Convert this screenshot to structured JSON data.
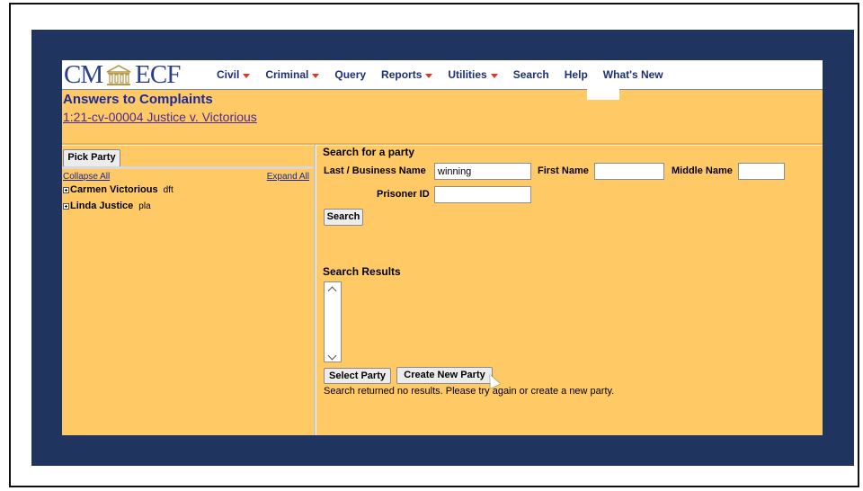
{
  "menu": {
    "items": [
      {
        "label": "Civil",
        "has_caret": true
      },
      {
        "label": "Criminal",
        "has_caret": true
      },
      {
        "label": "Query",
        "has_caret": false
      },
      {
        "label": "Reports",
        "has_caret": true
      },
      {
        "label": "Utilities",
        "has_caret": true
      },
      {
        "label": "Search",
        "has_caret": false
      },
      {
        "label": "Help",
        "has_caret": false
      },
      {
        "label": "What's New",
        "has_caret": false
      }
    ]
  },
  "logo": {
    "left": "CM",
    "right": "ECF",
    "icon": "courthouse-pillars-icon"
  },
  "page": {
    "title": "Answers to Complaints",
    "case_link": "1:21-cv-00004 Justice v. Victorious"
  },
  "left_panel": {
    "pick_party_label": "Pick Party",
    "collapse_all": "Collapse All",
    "expand_all": "Expand All",
    "parties": [
      {
        "name": "Carmen Victorious",
        "role": "dft"
      },
      {
        "name": "Linda Justice",
        "role": "pla"
      }
    ]
  },
  "search": {
    "heading": "Search for a party",
    "last_name_label": "Last / Business Name",
    "last_name_value": "winning",
    "first_name_label": "First Name",
    "first_name_value": "",
    "middle_name_label": "Middle Name",
    "middle_name_value": "",
    "prisoner_id_label": "Prisoner ID",
    "prisoner_id_value": "",
    "search_button": "Search"
  },
  "results": {
    "heading": "Search Results",
    "select_party_button": "Select Party",
    "create_new_party_button": "Create New Party",
    "status_message": "Search returned no results. Please try again or create a new party."
  },
  "colors": {
    "background_panel": "#ffc966",
    "outer_frame": "#1f3560",
    "menu_text": "#1b2f7a",
    "caret": "#d63a2a",
    "title": "#1a2a9a"
  }
}
